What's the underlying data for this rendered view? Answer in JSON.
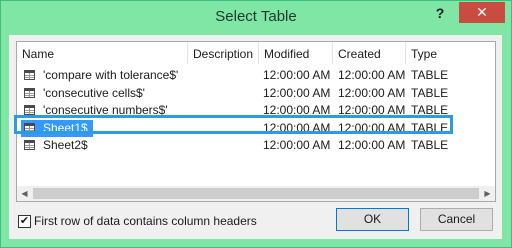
{
  "window": {
    "title": "Select Table",
    "help_label": "?",
    "close_label": "✕"
  },
  "columns": [
    "Name",
    "Description",
    "Modified",
    "Created",
    "Type"
  ],
  "rows": [
    {
      "name": "'compare with tolerance$'",
      "description": "",
      "modified": "12:00:00 AM",
      "created": "12:00:00 AM",
      "type": "TABLE",
      "selected": false
    },
    {
      "name": "'consecutive cells$'",
      "description": "",
      "modified": "12:00:00 AM",
      "created": "12:00:00 AM",
      "type": "TABLE",
      "selected": false
    },
    {
      "name": "'consecutive numbers$'",
      "description": "",
      "modified": "12:00:00 AM",
      "created": "12:00:00 AM",
      "type": "TABLE",
      "selected": false
    },
    {
      "name": "Sheet1$",
      "description": "",
      "modified": "12:00:00 AM",
      "created": "12:00:00 AM",
      "type": "TABLE",
      "selected": true
    },
    {
      "name": "Sheet2$",
      "description": "",
      "modified": "12:00:00 AM",
      "created": "12:00:00 AM",
      "type": "TABLE",
      "selected": false
    }
  ],
  "scrollbar": {
    "left_arrow": "◀",
    "right_arrow": "▶"
  },
  "options": {
    "header_checkbox_label": "First row of data contains column headers",
    "header_checkbox_checked": true,
    "check_mark": "✔"
  },
  "buttons": {
    "ok": "OK",
    "cancel": "Cancel"
  }
}
